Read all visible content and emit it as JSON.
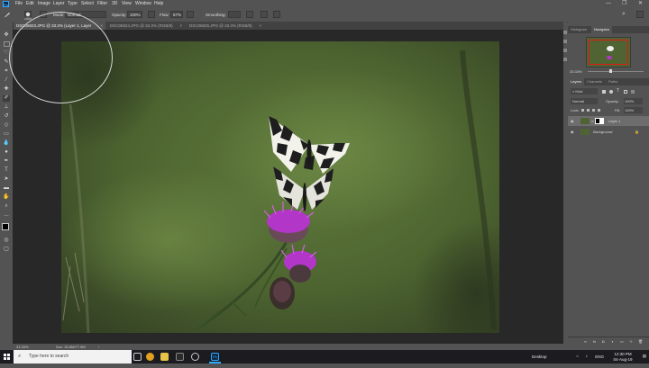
{
  "app": {
    "logo_text": "Ps"
  },
  "menu": {
    "items": [
      "File",
      "Edit",
      "Image",
      "Layer",
      "Type",
      "Select",
      "Filter",
      "3D",
      "View",
      "Window",
      "Help"
    ],
    "minimize": "—",
    "maximize": "❐",
    "close": "✕"
  },
  "options": {
    "brush_size": "1000",
    "mode_label": "Mode:",
    "mode_value": "Normal",
    "opacity_label": "Opacity:",
    "opacity_value": "100%",
    "flow_label": "Flow:",
    "flow_value": "67%",
    "smoothing_label": "Smoothing:"
  },
  "tabs": [
    {
      "label": "DSC06823.JPG @ 33.3% (Layer 1, Layer Mask/8)",
      "active": true
    },
    {
      "label": "DSC06824.JPG @ 33.3% (RGB/8)",
      "active": false
    },
    {
      "label": "DSC06825.JPG @ 33.3% (RGB/8)",
      "active": false
    }
  ],
  "status": {
    "zoom": "33.33%",
    "doc": "Doc: 26.8M/77.9M"
  },
  "panels": {
    "top_tabs": [
      "Histogram",
      "Navigator"
    ],
    "nav_zoom": "33.33%",
    "layer_tabs": [
      "Layers",
      "Channels",
      "Paths"
    ],
    "kind_label": "Kind",
    "blend_mode": "Normal",
    "opacity_label": "Opacity:",
    "opacity_value": "100%",
    "lock_label": "Lock:",
    "fill_label": "Fill:",
    "fill_value": "100%",
    "layers": [
      {
        "name": "Layer 1",
        "selected": true
      },
      {
        "name": "Background",
        "selected": false
      }
    ]
  },
  "taskbar": {
    "search_placeholder": "Type here to search",
    "desktop_label": "Desktop",
    "lang": "ENG",
    "time": "12:30 PM",
    "date": "04-Aug-19"
  },
  "colors": {
    "accent": "#31a8ff",
    "navigator_frame": "#e01818",
    "thistle": "#b236c8"
  }
}
